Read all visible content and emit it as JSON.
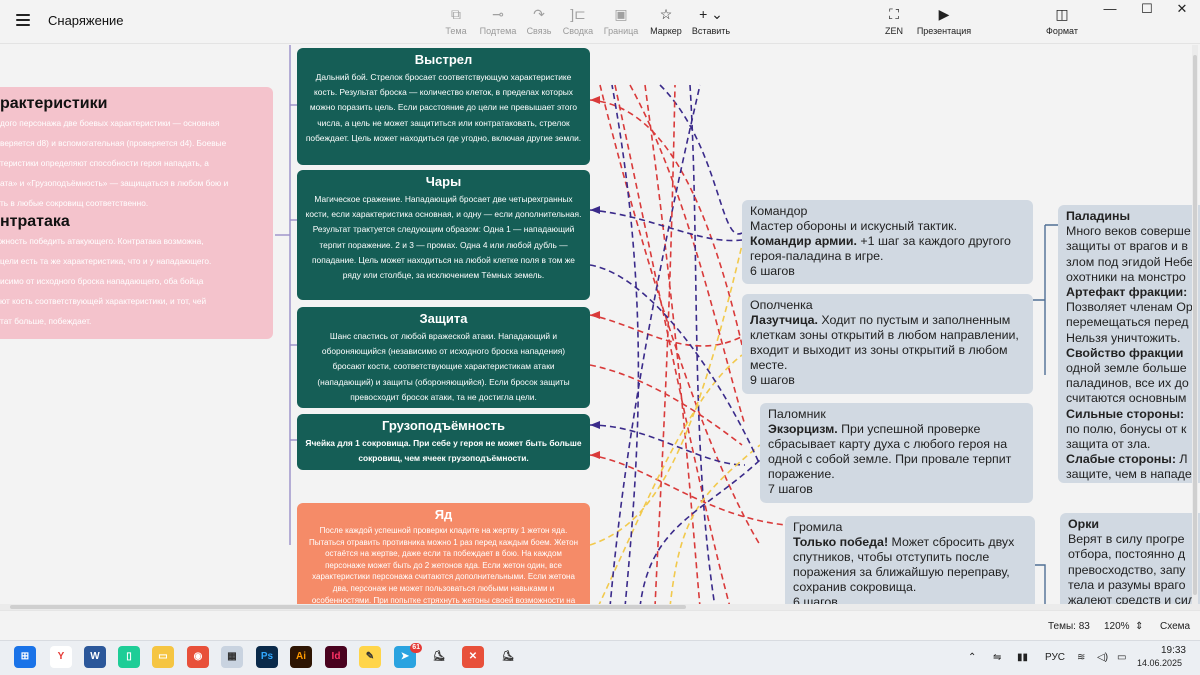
{
  "app": {
    "title": "Снаряжение"
  },
  "toolbar": {
    "items": [
      {
        "label": "Тема",
        "icon": "theme-icon"
      },
      {
        "label": "Подтема",
        "icon": "subtopic-icon"
      },
      {
        "label": "Связь",
        "icon": "relation-icon"
      },
      {
        "label": "Сводка",
        "icon": "summary-icon"
      },
      {
        "label": "Граница",
        "icon": "boundary-icon"
      },
      {
        "label": "Маркер",
        "icon": "star-icon"
      },
      {
        "label": "Вставить",
        "icon": "plus-icon"
      },
      {
        "label": "ZEN",
        "icon": "fullscreen-icon"
      },
      {
        "label": "Презентация",
        "icon": "presentation-icon"
      },
      {
        "label": "Формат",
        "icon": "format-panel-icon"
      }
    ]
  },
  "canvas": {
    "pink": {
      "title1": "рактеристики",
      "body1": [
        "дого персонажа две боевых характеристики — основная",
        "веряется d8) и вспомогательная (проверяется d4). Боевые",
        "теристики определяют способности героя нападать, а",
        "ата» и «Грузоподъёмность» — защищаться в любом бою и",
        "ть в любые сокровищ соответственно."
      ],
      "title2": "нтратака",
      "body2": [
        "жность победить атакующего. Контратака возможна,",
        "цели есть та же характеристика, что и у нападающего.",
        "исимо от исходного броска нападающего, оба бойца",
        "ют кость соответствующей характеристики, и тот, чей",
        "тат больше, побеждает."
      ]
    },
    "green": [
      {
        "title": "Выстрел",
        "body": "Дальний бой. Стрелок бросает соответствующую характеристике кость. Результат броска — количество клеток, в пределах которых можно поразить цель. Если расстояние до цели не превышает этого числа, а цель не может защититься или контратаковать, стрелок побеждает. Цель может находиться где угодно, включая другие земли."
      },
      {
        "title": "Чары",
        "body": "Магическое сражение. Нападающий бросает две четырехгранных кости, если характеристика основная, и одну — если дополнительная. Результат трактуется следующим образом: Одна 1 — нападающий терпит поражение. 2 и 3 — промах. Одна 4 или любой дубль — попадание. Цель может находиться на любой клетке поля в том же ряду или столбце, за исключением Тёмных земель."
      },
      {
        "title": "Защита",
        "body": "Шанс спастись от любой вражеской атаки. Нападающий и обороняющийся (независимо от исходного броска нападения) бросают кости, соответствующие характеристикам атаки (нападающий) и защиты (обороняющийся). Если бросок защиты превосходит бросок атаки, та не достигла цели."
      },
      {
        "title": "Грузоподъёмность",
        "body": "Ячейка для 1 сокровища. При себе у героя не может быть больше сокровищ, чем ячеек грузоподъёмности."
      }
    ],
    "orange": {
      "title": "Яд",
      "body": "После каждой успешной проверки кладите на жертву 1 жетон яда. Пытаться отравить противника можно 1 раз перед каждым боем. Жетон остаётся на жертве, даже если та побеждает в бою. На каждом персонаже может быть до 2 жетонов яда. Если жетон один, все характеристики персонажа считаются дополнительными. Если жетона два, персонаж не может пользоваться любыми навыками и особенностями. При попытке стряхнуть жетоны своей возможности на базу и не"
    },
    "heroes": [
      {
        "name": "Командор",
        "desc": "Мастер обороны и искусный тактик.",
        "ability": "Командир армии.",
        "ability_text": " +1 шаг за каждого другого героя-паладина в игре.",
        "steps": "6 шагов"
      },
      {
        "name": "Ополченка",
        "desc": "",
        "ability": "Лазутчица.",
        "ability_text": " Ходит по пустым и заполненным клеткам зоны открытий в любом направлении, входит и выходит из зоны открытий в любом месте.",
        "steps": "9 шагов"
      },
      {
        "name": "Паломник",
        "desc": "",
        "ability": "Экзорцизм.",
        "ability_text": " При успешной проверке сбрасывает карту духа с любого героя на одной с собой земле. При провале терпит поражение.",
        "steps": "7 шагов"
      },
      {
        "name": "Громила",
        "desc": "",
        "ability": "Только победа!",
        "ability_text": " Может сбросить двух спутников, чтобы отступить после поражения за ближайшую переправу, сохранив сокровища.",
        "steps": "6 шагов"
      }
    ],
    "factions": [
      {
        "name": "Паладины",
        "lines": [
          {
            "b": "",
            "t": "Много веков соверше"
          },
          {
            "b": "",
            "t": "защиты от врагов и в"
          },
          {
            "b": "",
            "t": "злом под эгидой Небе"
          },
          {
            "b": "",
            "t": "охотники на монстро"
          },
          {
            "b": "Артефакт фракции:",
            "t": ""
          },
          {
            "b": "",
            "t": "Позволяет членам Ор"
          },
          {
            "b": "",
            "t": "перемещаться перед"
          },
          {
            "b": "",
            "t": "Нельзя уничтожить."
          },
          {
            "b": "Свойство фракции",
            "t": ""
          },
          {
            "b": "",
            "t": "одной земле больше"
          },
          {
            "b": "",
            "t": "паладинов, все их до"
          },
          {
            "b": "",
            "t": "считаются основным"
          },
          {
            "b": "Сильные стороны:",
            "t": ""
          },
          {
            "b": "",
            "t": "по полю, бонусы от к"
          },
          {
            "b": "",
            "t": "защита от зла."
          },
          {
            "b": "Слабые стороны:",
            "t": " Л"
          },
          {
            "b": "",
            "t": "защите, чем в нападе"
          }
        ]
      },
      {
        "name": "Орки",
        "lines": [
          {
            "b": "",
            "t": "Верят в силу прогре"
          },
          {
            "b": "",
            "t": "отбора, постоянно д"
          },
          {
            "b": "",
            "t": "превосходство, запу"
          },
          {
            "b": "",
            "t": "тела и разумы враго"
          },
          {
            "b": "",
            "t": "жалеют средств и сил"
          }
        ]
      }
    ]
  },
  "status": {
    "topics": "Темы: 83",
    "zoom": "120%",
    "view": "Схема"
  },
  "taskbar": {
    "apps": [
      "Windows",
      "Yandex",
      "Word",
      "Notepad",
      "Explorer",
      "Alice",
      "Photos",
      "Photoshop",
      "Illustrator",
      "InDesign",
      "Notes",
      "Telegram",
      "App",
      "XMind",
      "App2"
    ],
    "telegram_badge": "61",
    "lang": "РУС",
    "time": "19:33",
    "date": "14.06.2025"
  },
  "colors": {
    "green": "#155e56",
    "pink": "#f4c3cc",
    "orange": "#f58b68",
    "hero": "#d1d9e2",
    "red_line": "#d93a3a",
    "blue_line": "#3a2a8a",
    "yellow_line": "#f2c94c"
  }
}
